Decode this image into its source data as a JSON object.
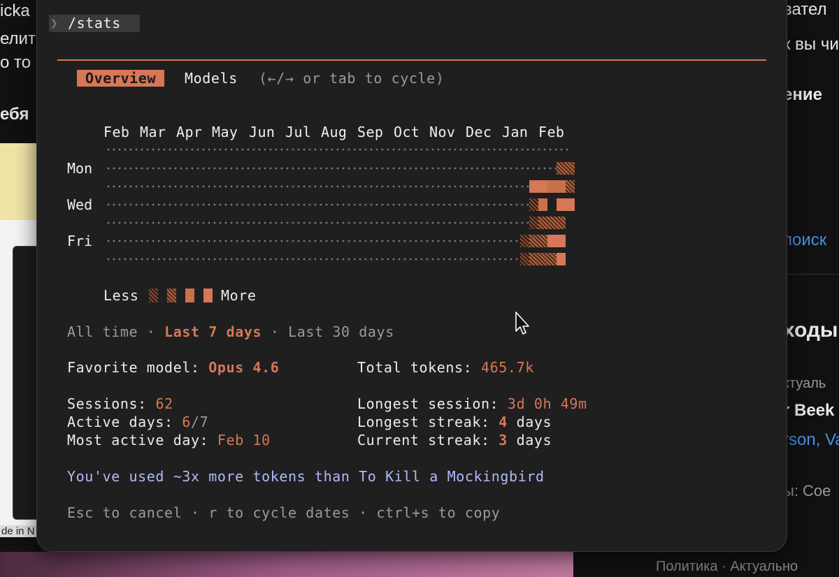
{
  "background": {
    "left_fragments": [
      "icka",
      "елит",
      "о то",
      "ебя"
    ],
    "left_caption": "de in N",
    "right_fragments": [
      "вател",
      "к вы чи",
      "ение",
      "поиск",
      "ходы",
      "ктуаль",
      "r Beek",
      "rson, Va",
      "ы: Сое"
    ],
    "bottom_right_text": "Политика · Актуально"
  },
  "terminal": {
    "prompt_glyph": "❯",
    "command": "/stats",
    "tabs": {
      "active": "Overview",
      "other": "Models",
      "hint": "(←/→ or tab to cycle)"
    },
    "heatmap": {
      "months": [
        "Feb",
        "Mar",
        "Apr",
        "May",
        "Jun",
        "Jul",
        "Aug",
        "Sep",
        "Oct",
        "Nov",
        "Dec",
        "Jan",
        "Feb"
      ],
      "day_labels": [
        "Mon",
        "Wed",
        "Fri"
      ],
      "legend_less": "Less",
      "legend_more": "More",
      "accent_color": "#d77757"
    },
    "ranges": {
      "all_time": "All time",
      "sep": "·",
      "last_7": "Last 7 days",
      "last_30": "Last 30 days"
    },
    "stats": {
      "favorite_model_label": "Favorite model:",
      "favorite_model_value": "Opus 4.6",
      "total_tokens_label": "Total tokens:",
      "total_tokens_value": "465.7k",
      "sessions_label": "Sessions:",
      "sessions_value": "62",
      "longest_session_label": "Longest session:",
      "longest_session_value": "3d 0h 49m",
      "active_days_label": "Active days:",
      "active_days_value": "6",
      "active_days_total": "/7",
      "longest_streak_label": "Longest streak:",
      "longest_streak_value": "4",
      "longest_streak_unit": "days",
      "most_active_label": "Most active day:",
      "most_active_value": "Feb 10",
      "current_streak_label": "Current streak:",
      "current_streak_value": "3",
      "current_streak_unit": "days"
    },
    "fun_fact": "You've used ~3x more tokens than To Kill a Mockingbird",
    "footer": "Esc to cancel · r to cycle dates · ctrl+s to copy"
  }
}
